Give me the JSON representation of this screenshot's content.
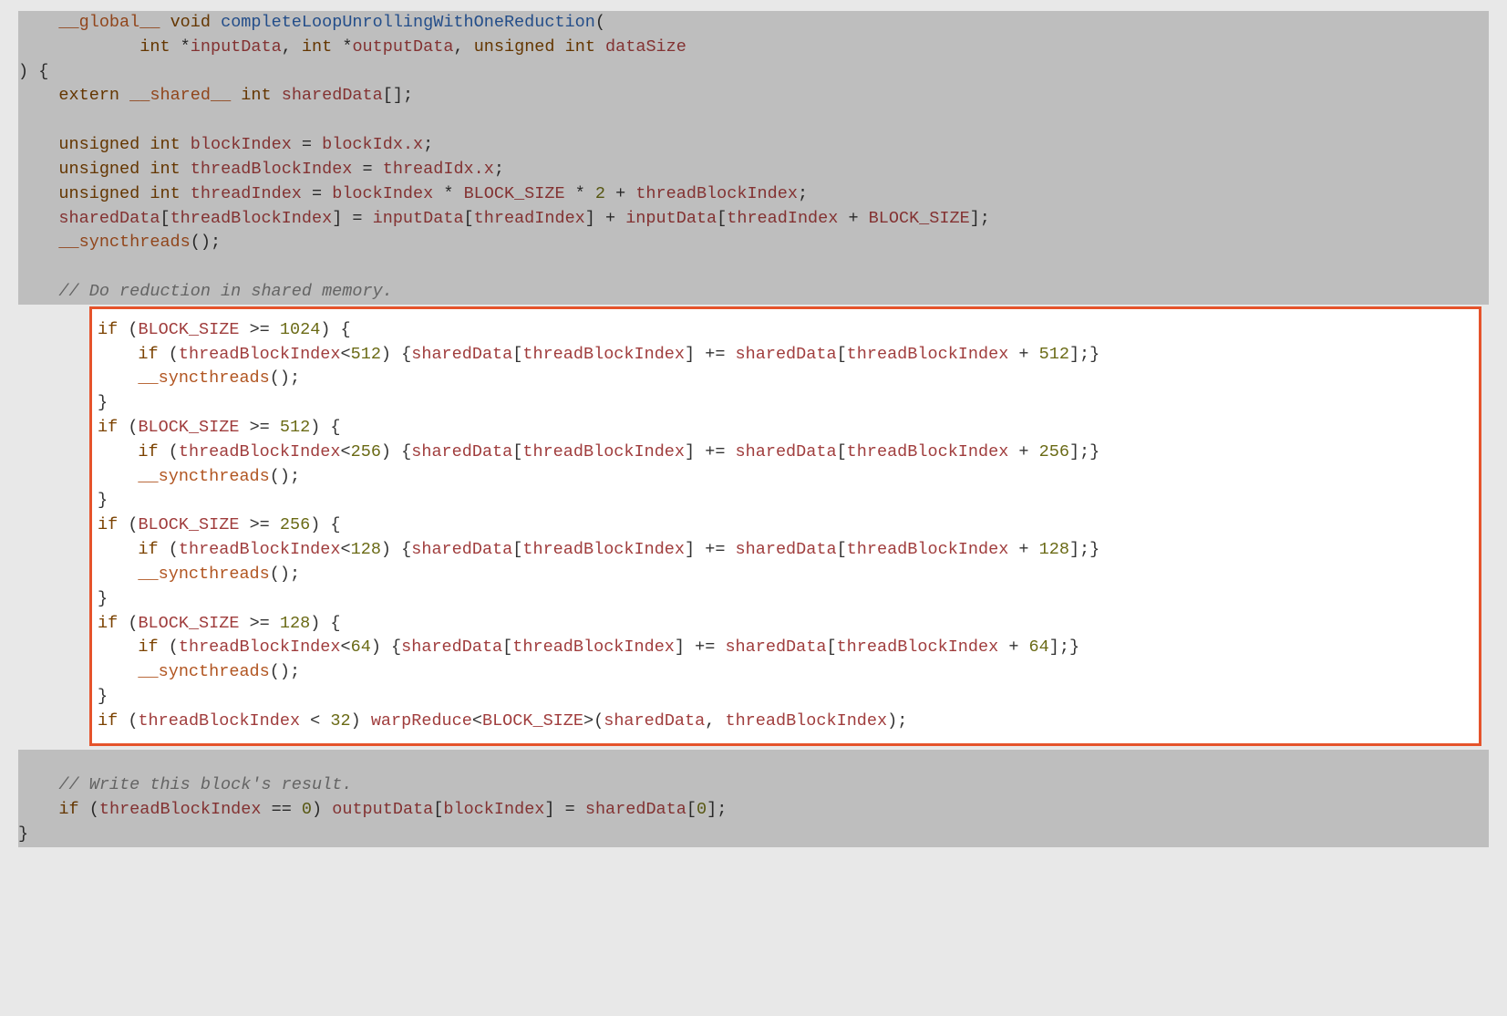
{
  "sig": {
    "global": "__global__",
    "void": "void",
    "fn": "completeLoopUnrollingWithOneReduction",
    "p_int1": "int",
    "p_star1": "*",
    "p_input": "inputData",
    "p_int2": "int",
    "p_star2": "*",
    "p_output": "outputData",
    "p_uns": "unsigned",
    "p_int3": "int",
    "p_size": "dataSize",
    "open": ") {"
  },
  "decl": {
    "extern": "extern",
    "shared": "__shared__",
    "int": "int",
    "sharedData": "sharedData",
    "brackets": "[];"
  },
  "vars": {
    "uns": "unsigned",
    "int": "int",
    "bi": "blockIndex",
    "bi_rhs": "blockIdx.x",
    "tbi": "threadBlockIndex",
    "tbi_rhs": "threadIdx.x",
    "ti": "threadIndex",
    "ti_rhs_a": "blockIndex",
    "ti_rhs_b": "BLOCK_SIZE",
    "ti_rhs_c": "2",
    "ti_rhs_d": "threadBlockIndex",
    "sd": "sharedData",
    "in": "inputData",
    "bs": "BLOCK_SIZE",
    "sync": "__syncthreads"
  },
  "cmt1": "// Do reduction in shared memory.",
  "red": {
    "if": "if",
    "bs": "BLOCK_SIZE",
    "tbi": "threadBlockIndex",
    "sd": "sharedData",
    "sync": "__syncthreads",
    "b1": {
      "th": "1024",
      "half": "512"
    },
    "b2": {
      "th": "512",
      "half": "256"
    },
    "b3": {
      "th": "256",
      "half": "128"
    },
    "b4": {
      "th": "128",
      "half": "64"
    },
    "warp_th": "32",
    "warp_fn": "warpReduce",
    "warp_tpl": "BLOCK_SIZE"
  },
  "cmt2": "// Write this block's result.",
  "out": {
    "if": "if",
    "tbi": "threadBlockIndex",
    "zero": "0",
    "out": "outputData",
    "bi": "blockIndex",
    "sd": "sharedData"
  },
  "close": "}"
}
